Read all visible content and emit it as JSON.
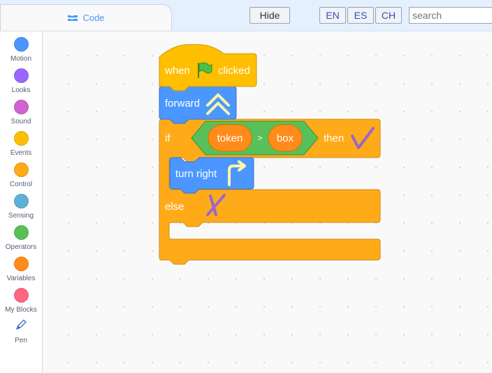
{
  "tabs": {
    "code_label": "Code"
  },
  "toolbar": {
    "hide_label": "Hide",
    "languages": [
      "EN",
      "ES",
      "CH"
    ],
    "search_placeholder": "search"
  },
  "categories": [
    {
      "label": "Motion",
      "color": "#4c97ff"
    },
    {
      "label": "Looks",
      "color": "#9966ff"
    },
    {
      "label": "Sound",
      "color": "#cf63cf"
    },
    {
      "label": "Events",
      "color": "#ffbf00"
    },
    {
      "label": "Control",
      "color": "#ffab19"
    },
    {
      "label": "Sensing",
      "color": "#5cb1d6"
    },
    {
      "label": "Operators",
      "color": "#59c059"
    },
    {
      "label": "Variables",
      "color": "#ff8c1a"
    },
    {
      "label": "My Blocks",
      "color": "#ff6680"
    },
    {
      "label": "Pen",
      "color": "#0fbd8c"
    }
  ],
  "script": {
    "hat": {
      "when": "when",
      "clicked": "clicked"
    },
    "forward": "forward",
    "if": {
      "if": "if",
      "then": "then",
      "else": "else"
    },
    "condition": {
      "left": "token",
      "op": ">",
      "right": "box"
    },
    "turn_right": "turn right"
  },
  "colors": {
    "events": "#ffbf00",
    "control": "#ffab19",
    "motion": "#4c97ff",
    "operators": "#59c059",
    "reporter": "#ff8c1a",
    "check": "#9966cc"
  }
}
